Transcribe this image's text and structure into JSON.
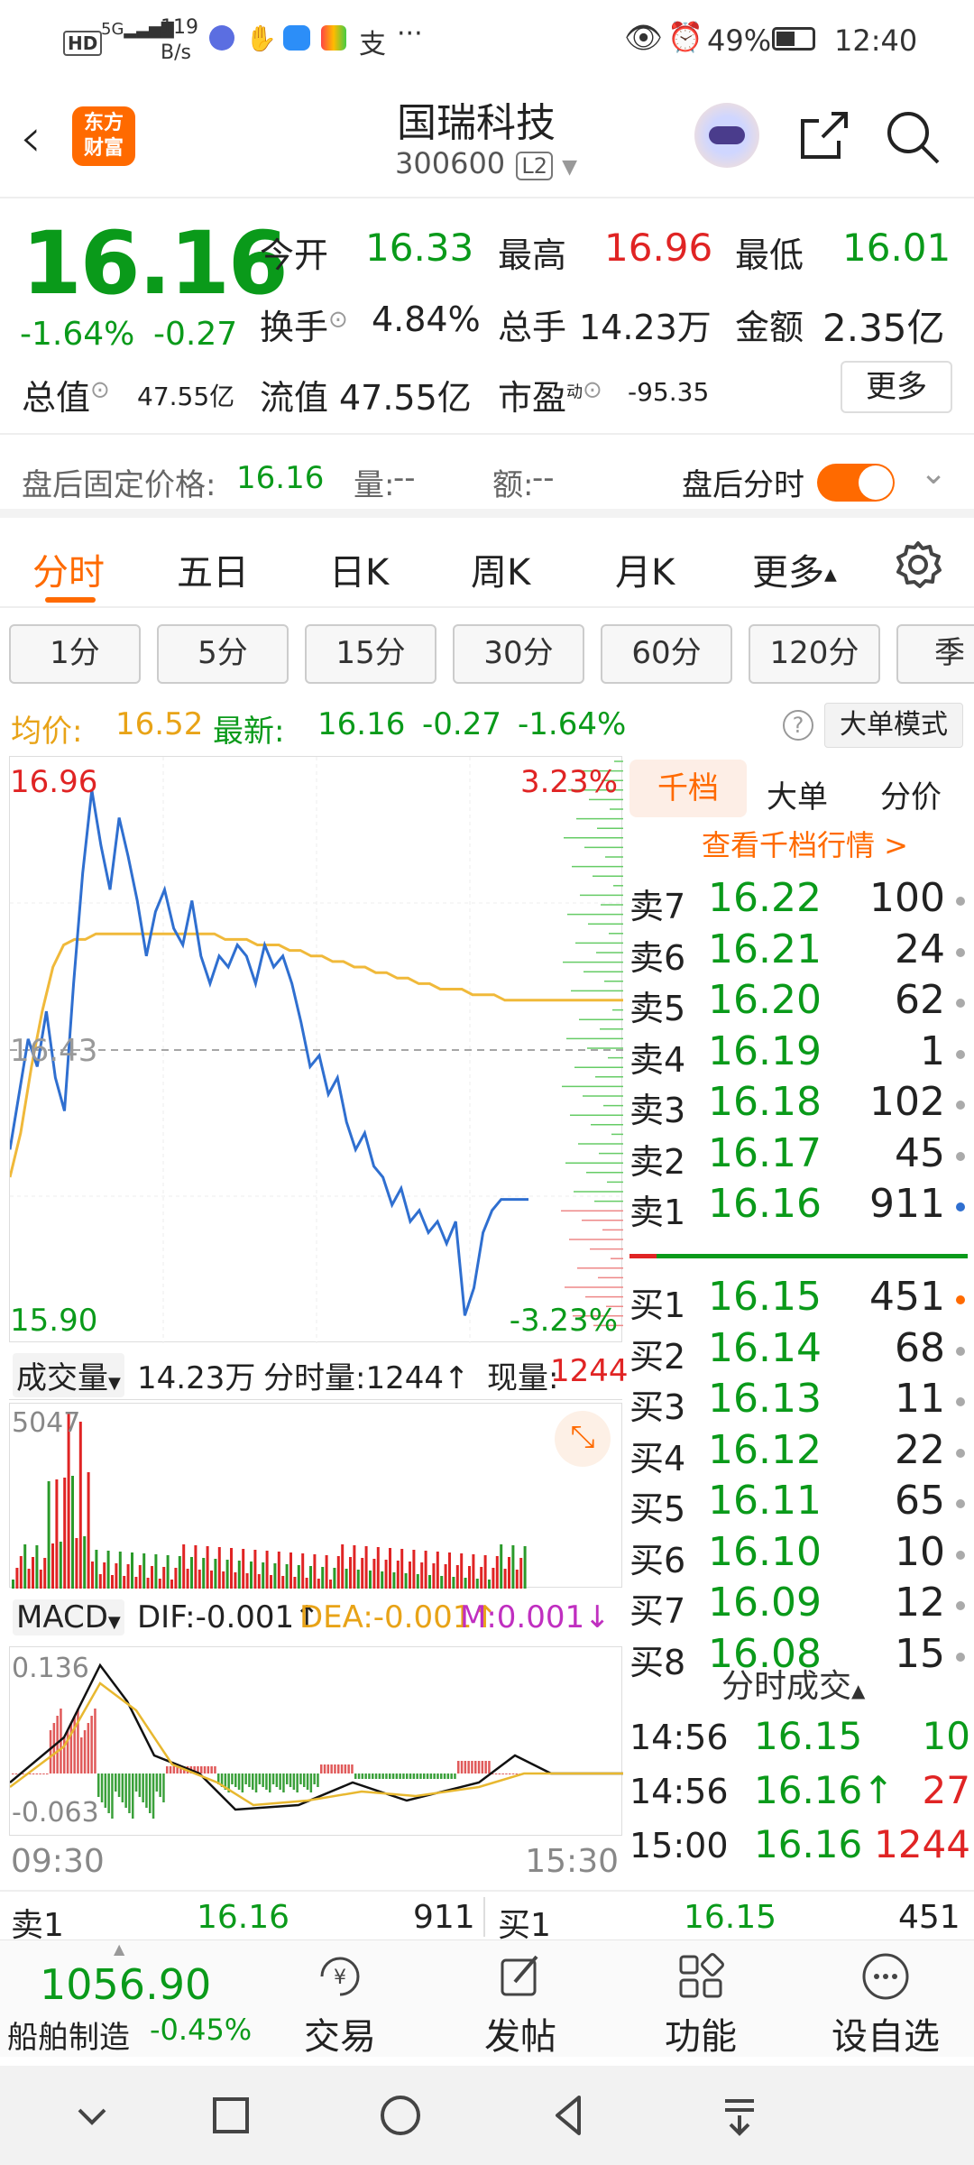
{
  "status_bar": {
    "left_icons": [
      "hd-icon",
      "5g-signal-icon"
    ],
    "net_speed": "119",
    "net_unit": "B/s",
    "battery_pct": "49%",
    "time": "12:40"
  },
  "nav": {
    "logo_text": "东方\n财富",
    "stock_name": "国瑞科技",
    "stock_code": "300600",
    "level_badge": "L2"
  },
  "quote": {
    "price": "16.16",
    "change_pct": "-1.64%",
    "change": "-0.27",
    "open_label": "今开",
    "open": "16.33",
    "high_label": "最高",
    "high": "16.96",
    "low_label": "最低",
    "low": "16.01",
    "turnover_label": "换手",
    "turnover": "4.84%",
    "volume_label": "总手",
    "volume": "14.23万",
    "amount_label": "金额",
    "amount": "2.35亿",
    "mktcap_label": "总值",
    "mktcap": "47.55亿",
    "float_label": "流值",
    "float_cap": "47.55亿",
    "pe_label": "市盈",
    "pe_sup": "动",
    "pe": "-95.35",
    "more_button": "更多"
  },
  "after_hours": {
    "price_label": "盘后固定价格:",
    "price": "16.16",
    "volume_label": "量:",
    "volume": "--",
    "amount_label": "额:",
    "amount": "--",
    "toggle_label": "盘后分时"
  },
  "tabs": [
    "分时",
    "五日",
    "日K",
    "周K",
    "月K",
    "更多"
  ],
  "subtabs": [
    "1分",
    "5分",
    "15分",
    "30分",
    "60分",
    "120分",
    "季"
  ],
  "price_line": {
    "avg_label": "均价:",
    "avg": "16.52",
    "latest_label": "最新:",
    "latest": "16.16",
    "change": "-0.27",
    "change_pct": "-1.64%",
    "mode_button": "大单模式"
  },
  "chart_data": {
    "type": "line",
    "title": "",
    "y_top_label": "16.96",
    "y_mid_label": "16.43",
    "y_bottom_label": "15.90",
    "pct_top_label": "3.23%",
    "pct_bottom_label": "-3.23%",
    "ylim": [
      15.9,
      16.96
    ],
    "x_start": "09:30",
    "x_end": "15:30",
    "series": [
      {
        "name": "",
        "color": "#2f6fd0",
        "values": [
          16.25,
          16.35,
          16.45,
          16.4,
          16.5,
          16.38,
          16.32,
          16.55,
          16.75,
          16.9,
          16.8,
          16.72,
          16.85,
          16.78,
          16.7,
          16.6,
          16.68,
          16.72,
          16.65,
          16.62,
          16.7,
          16.6,
          16.55,
          16.6,
          16.58,
          16.62,
          16.6,
          16.55,
          16.62,
          16.58,
          16.6,
          16.55,
          16.48,
          16.4,
          16.42,
          16.35,
          16.38,
          16.3,
          16.25,
          16.28,
          16.22,
          16.2,
          16.15,
          16.18,
          16.12,
          16.14,
          16.1,
          16.12,
          16.08,
          16.12,
          15.95,
          16.0,
          16.1,
          16.14,
          16.16,
          16.16,
          16.16,
          16.16
        ]
      },
      {
        "name": "",
        "color": "#f0b93a",
        "values": [
          16.2,
          16.28,
          16.4,
          16.5,
          16.58,
          16.62,
          16.63,
          16.63,
          16.64,
          16.64,
          16.64,
          16.64,
          16.64,
          16.64,
          16.64,
          16.64,
          16.64,
          16.64,
          16.64,
          16.64,
          16.63,
          16.63,
          16.63,
          16.62,
          16.62,
          16.62,
          16.61,
          16.61,
          16.6,
          16.6,
          16.59,
          16.59,
          16.58,
          16.58,
          16.57,
          16.57,
          16.56,
          16.56,
          16.55,
          16.55,
          16.54,
          16.54,
          16.54,
          16.53,
          16.53,
          16.53,
          16.52,
          16.52,
          16.52,
          16.52,
          16.52,
          16.52,
          16.52,
          16.52,
          16.52,
          16.52,
          16.52,
          16.52
        ]
      }
    ]
  },
  "orderbook": {
    "tabs": [
      "千档",
      "大单",
      "分价"
    ],
    "link": "查看千档行情 >",
    "asks": [
      {
        "label": "卖7",
        "price": "16.22",
        "vol": "100"
      },
      {
        "label": "卖6",
        "price": "16.21",
        "vol": "24"
      },
      {
        "label": "卖5",
        "price": "16.20",
        "vol": "62"
      },
      {
        "label": "卖4",
        "price": "16.19",
        "vol": "1"
      },
      {
        "label": "卖3",
        "price": "16.18",
        "vol": "102"
      },
      {
        "label": "卖2",
        "price": "16.17",
        "vol": "45"
      },
      {
        "label": "卖1",
        "price": "16.16",
        "vol": "911"
      }
    ],
    "bids": [
      {
        "label": "买1",
        "price": "16.15",
        "vol": "451"
      },
      {
        "label": "买2",
        "price": "16.14",
        "vol": "68"
      },
      {
        "label": "买3",
        "price": "16.13",
        "vol": "11"
      },
      {
        "label": "买4",
        "price": "16.12",
        "vol": "22"
      },
      {
        "label": "买5",
        "price": "16.11",
        "vol": "65"
      },
      {
        "label": "买6",
        "price": "16.10",
        "vol": "10"
      },
      {
        "label": "买7",
        "price": "16.09",
        "vol": "12"
      },
      {
        "label": "买8",
        "price": "16.08",
        "vol": "15"
      }
    ]
  },
  "volume": {
    "selector": "成交量",
    "total": "14.23万",
    "tick_label": "分时量:1244↑",
    "now_label": "现量:",
    "now": "1244",
    "max_label": "5047"
  },
  "macd": {
    "selector": "MACD",
    "dif": "DIF:-0.001↑",
    "dea": "DEA:-0.001↑",
    "m": "M:0.001↓",
    "top_label": "0.136",
    "bottom_label": "-0.063"
  },
  "ticks": {
    "header": "分时成交",
    "rows": [
      {
        "time": "14:56",
        "price": "16.15",
        "vol": "10",
        "price_color": "green",
        "vol_color": "green"
      },
      {
        "time": "14:56",
        "price": "16.16↑",
        "vol": "27",
        "price_color": "green",
        "vol_color": "red"
      },
      {
        "time": "15:00",
        "price": "16.16",
        "vol": "1244",
        "price_color": "green",
        "vol_color": "red"
      }
    ]
  },
  "bottom_quote": {
    "ask_label": "卖1",
    "ask_price": "16.16",
    "ask_vol": "911",
    "bid_label": "买1",
    "bid_price": "16.15",
    "bid_vol": "451"
  },
  "bottom_bar": {
    "index_value": "1056.90",
    "index_name": "船舶制造",
    "index_change": "-0.45%",
    "items": [
      "交易",
      "发帖",
      "功能",
      "设自选"
    ]
  }
}
